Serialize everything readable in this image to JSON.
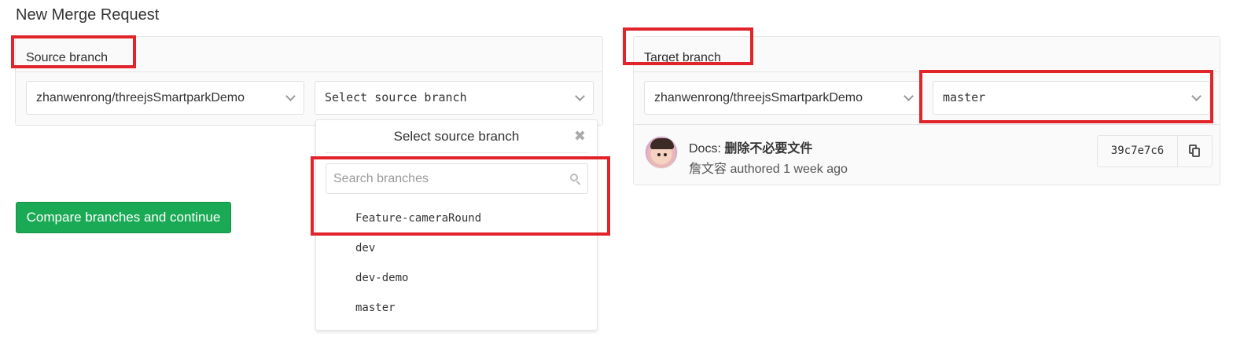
{
  "page": {
    "title": "New Merge Request"
  },
  "source": {
    "heading": "Source branch",
    "project": "zhanwenrong/threejsSmartparkDemo",
    "branch_placeholder": "Select source branch"
  },
  "target": {
    "heading": "Target branch",
    "project": "zhanwenrong/threejsSmartparkDemo",
    "branch": "master"
  },
  "compare_button": "Compare branches and continue",
  "dropdown": {
    "title": "Select source branch",
    "close": "✖",
    "search_placeholder": "Search branches",
    "items": [
      "Feature-cameraRound",
      "dev",
      "dev-demo",
      "master"
    ]
  },
  "commit": {
    "prefix": "Docs: ",
    "message": "删除不必要文件",
    "author": "詹文容",
    "authored": "authored 1 week ago",
    "sha": "39c7e7c6"
  },
  "colors": {
    "highlight": "#e0242a",
    "primary_button": "#1aaa55"
  },
  "icons": [
    "chevron-down-icon",
    "close-icon",
    "search-icon",
    "copy-icon"
  ]
}
